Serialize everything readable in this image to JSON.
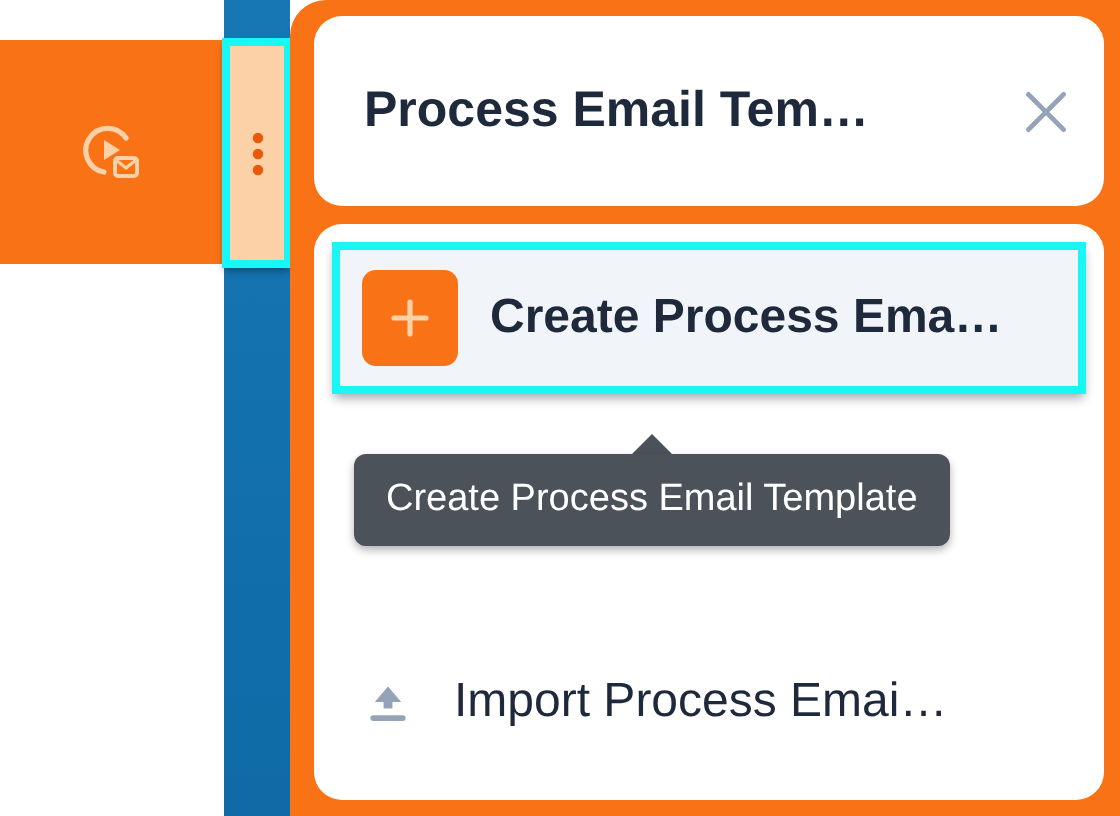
{
  "sidebar": {
    "handle": {
      "selected": true
    }
  },
  "panel": {
    "title": "Process Email Tem…"
  },
  "menu": {
    "items": [
      {
        "kind": "create",
        "label": "Create Process Ema…",
        "selected": true
      },
      {
        "kind": "import",
        "label": "Import Process Emai…",
        "selected": false
      }
    ]
  },
  "tooltip": {
    "text": "Create Process Email Template"
  }
}
